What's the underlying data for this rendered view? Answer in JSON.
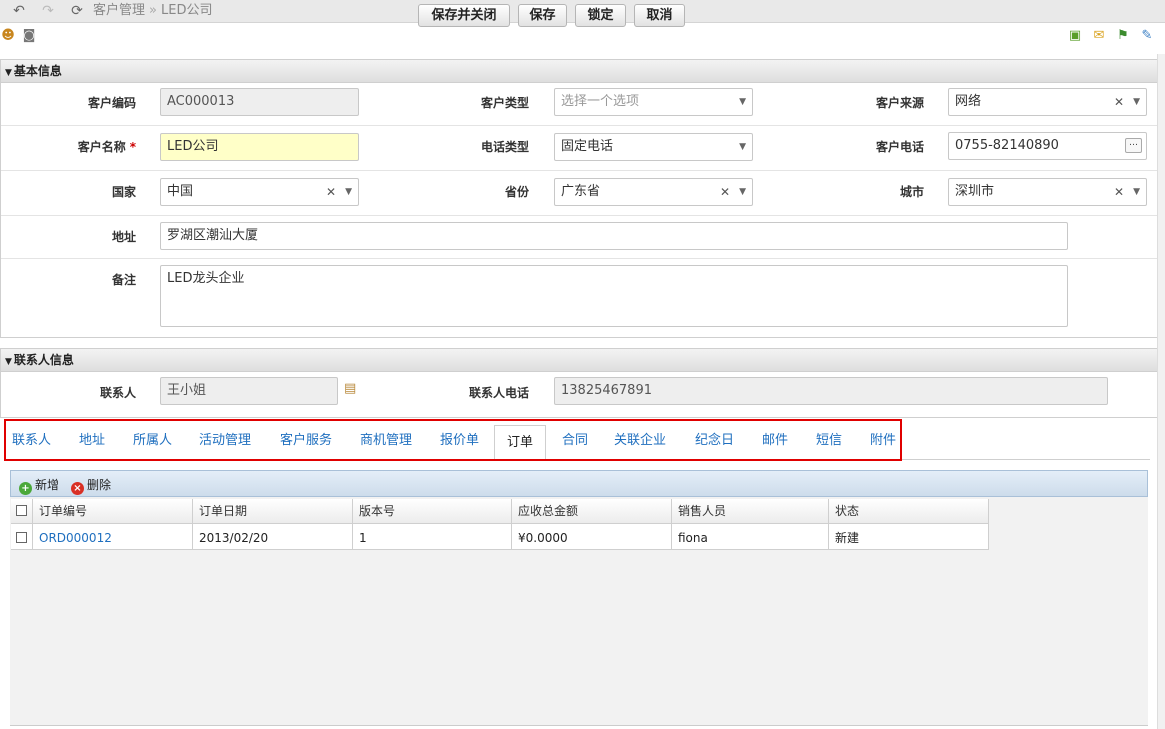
{
  "breadcrumb": {
    "section": "客户管理",
    "separator": "»",
    "current": "LED公司"
  },
  "toolbar": {
    "save_close": "保存并关闭",
    "save": "保存",
    "lock": "锁定",
    "cancel": "取消"
  },
  "basic_panel": {
    "title": "基本信息",
    "customer_code": {
      "label": "客户编码",
      "value": "AC000013"
    },
    "customer_type": {
      "label": "客户类型",
      "placeholder": "选择一个选项"
    },
    "customer_source": {
      "label": "客户来源",
      "value": "网络"
    },
    "customer_name": {
      "label": "客户名称",
      "required_mark": "*",
      "value": "LED公司"
    },
    "phone_type": {
      "label": "电话类型",
      "value": "固定电话"
    },
    "customer_phone": {
      "label": "客户电话",
      "value": "0755-82140890"
    },
    "country": {
      "label": "国家",
      "value": "中国"
    },
    "province": {
      "label": "省份",
      "value": "广东省"
    },
    "city": {
      "label": "城市",
      "value": "深圳市"
    },
    "address": {
      "label": "地址",
      "value": "罗湖区潮汕大厦"
    },
    "remark": {
      "label": "备注",
      "value": "LED龙头企业"
    }
  },
  "contact_panel": {
    "title": "联系人信息",
    "contact": {
      "label": "联系人",
      "value": "王小姐"
    },
    "contact_phone": {
      "label": "联系人电话",
      "value": "13825467891"
    }
  },
  "tabs": [
    {
      "label": "联系人"
    },
    {
      "label": "地址"
    },
    {
      "label": "所属人"
    },
    {
      "label": "活动管理"
    },
    {
      "label": "客户服务"
    },
    {
      "label": "商机管理"
    },
    {
      "label": "报价单"
    },
    {
      "label": "订单",
      "active": true
    },
    {
      "label": "合同"
    },
    {
      "label": "关联企业"
    },
    {
      "label": "纪念日"
    },
    {
      "label": "邮件"
    },
    {
      "label": "短信"
    },
    {
      "label": "附件"
    }
  ],
  "grid": {
    "add_label": "新增",
    "delete_label": "删除",
    "columns": [
      "订单编号",
      "订单日期",
      "版本号",
      "应收总金额",
      "销售人员",
      "状态"
    ],
    "rows": [
      [
        "ORD000012",
        "2013/02/20",
        "1",
        "¥0.0000",
        "fiona",
        "新建"
      ]
    ]
  },
  "colors": {
    "tab_link": "#1f6fbf",
    "highlight_box": "#e00000",
    "required_field": "#ffffc8"
  },
  "icons": [
    "back-icon",
    "forward-icon",
    "refresh-icon",
    "user-icon",
    "camera-icon",
    "chat-icon",
    "mail-icon",
    "flag-icon",
    "message-icon",
    "add-icon",
    "delete-icon",
    "clipboard-icon"
  ]
}
